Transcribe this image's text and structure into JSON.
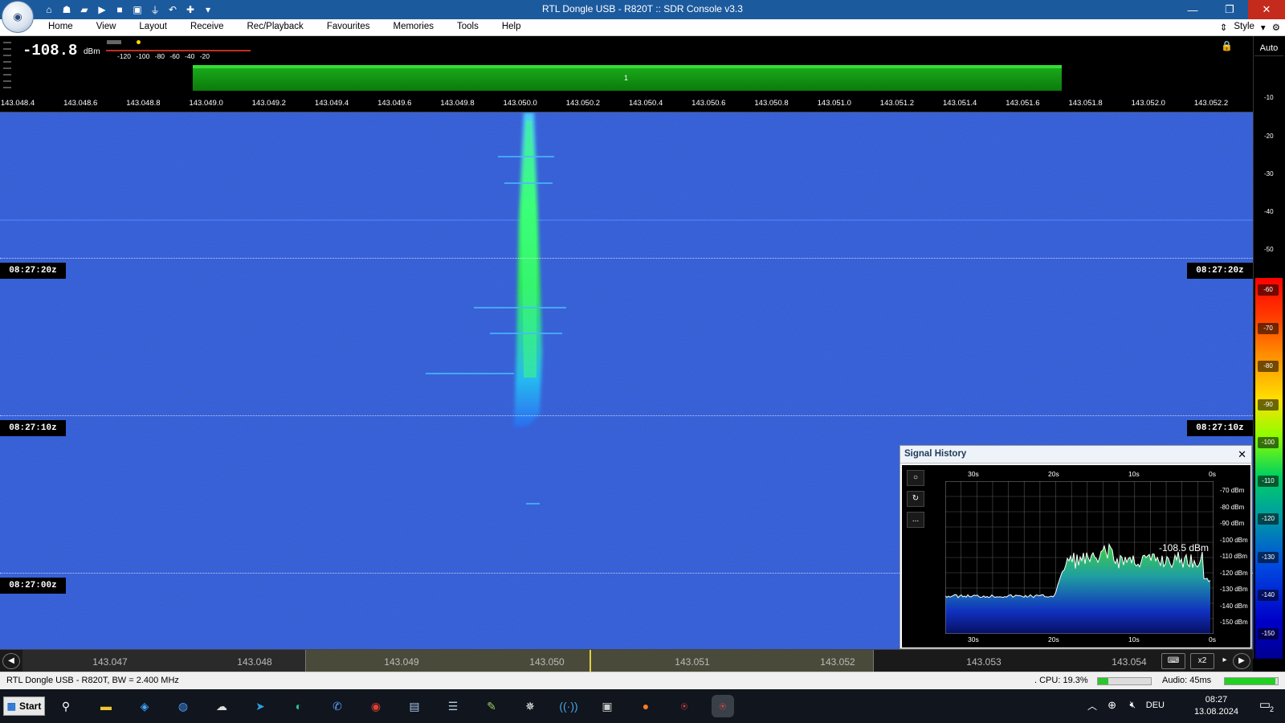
{
  "window": {
    "title": "RTL Dongle USB - R820T :: SDR Console v3.3"
  },
  "menu": {
    "items": [
      "Home",
      "View",
      "Layout",
      "Receive",
      "Rec/Playback",
      "Favourites",
      "Memories",
      "Tools",
      "Help"
    ],
    "style_label": "Style"
  },
  "signal_meter": {
    "level": "-108.8",
    "unit": "dBm",
    "scale_labels": "-120 -100 -80 -60 -40 -20"
  },
  "spectrum": {
    "passband_label": "1",
    "auto_label": "Auto",
    "frequency_labels": [
      "143.048.4",
      "143.048.6",
      "143.048.8",
      "143.049.0",
      "143.049.2",
      "143.049.4",
      "143.049.6",
      "143.049.8",
      "143.050.0",
      "143.050.2",
      "143.050.4",
      "143.050.6",
      "143.050.8",
      "143.051.0",
      "143.051.2",
      "143.051.4",
      "143.051.6",
      "143.051.8",
      "143.052.0",
      "143.052.2"
    ],
    "db_scale": [
      "-10",
      "-20",
      "-30",
      "-40",
      "-50"
    ],
    "colorbar_labels": [
      "-60",
      "-70",
      "-80",
      "-90",
      "-100",
      "-110",
      "-120",
      "-130",
      "-140",
      "-150"
    ]
  },
  "waterfall": {
    "time_markers": [
      "08:27:20z",
      "08:27:10z",
      "08:27:00z"
    ]
  },
  "signal_history": {
    "title": "Signal History",
    "current_value": "-108.5 dBm",
    "time_labels": [
      "30s",
      "20s",
      "10s",
      "0s"
    ],
    "y_labels": [
      "-70 dBm",
      "-80 dBm",
      "-90 dBm",
      "-100 dBm",
      "-110 dBm",
      "-120 dBm",
      "-130 dBm",
      "-140 dBm",
      "-150 dBm"
    ],
    "tools": [
      "○",
      "↻",
      "..."
    ]
  },
  "bottom_bar": {
    "frequency_labels": [
      "143.047",
      "143.048",
      "143.049",
      "143.050",
      "143.051",
      "143.052",
      "143.053",
      "143.054"
    ],
    "zoom_label": "x2"
  },
  "status": {
    "device": "RTL Dongle USB - R820T, BW = 2.400 MHz",
    "cpu": ". CPU: 19.3%",
    "cpu_percent": 19.3,
    "audio": "Audio: 45ms",
    "audio_level": 0.95
  },
  "taskbar": {
    "start_label": "Start",
    "language": "DEU",
    "time": "08:27",
    "date": "13.08.2024",
    "notification_count": "2"
  }
}
